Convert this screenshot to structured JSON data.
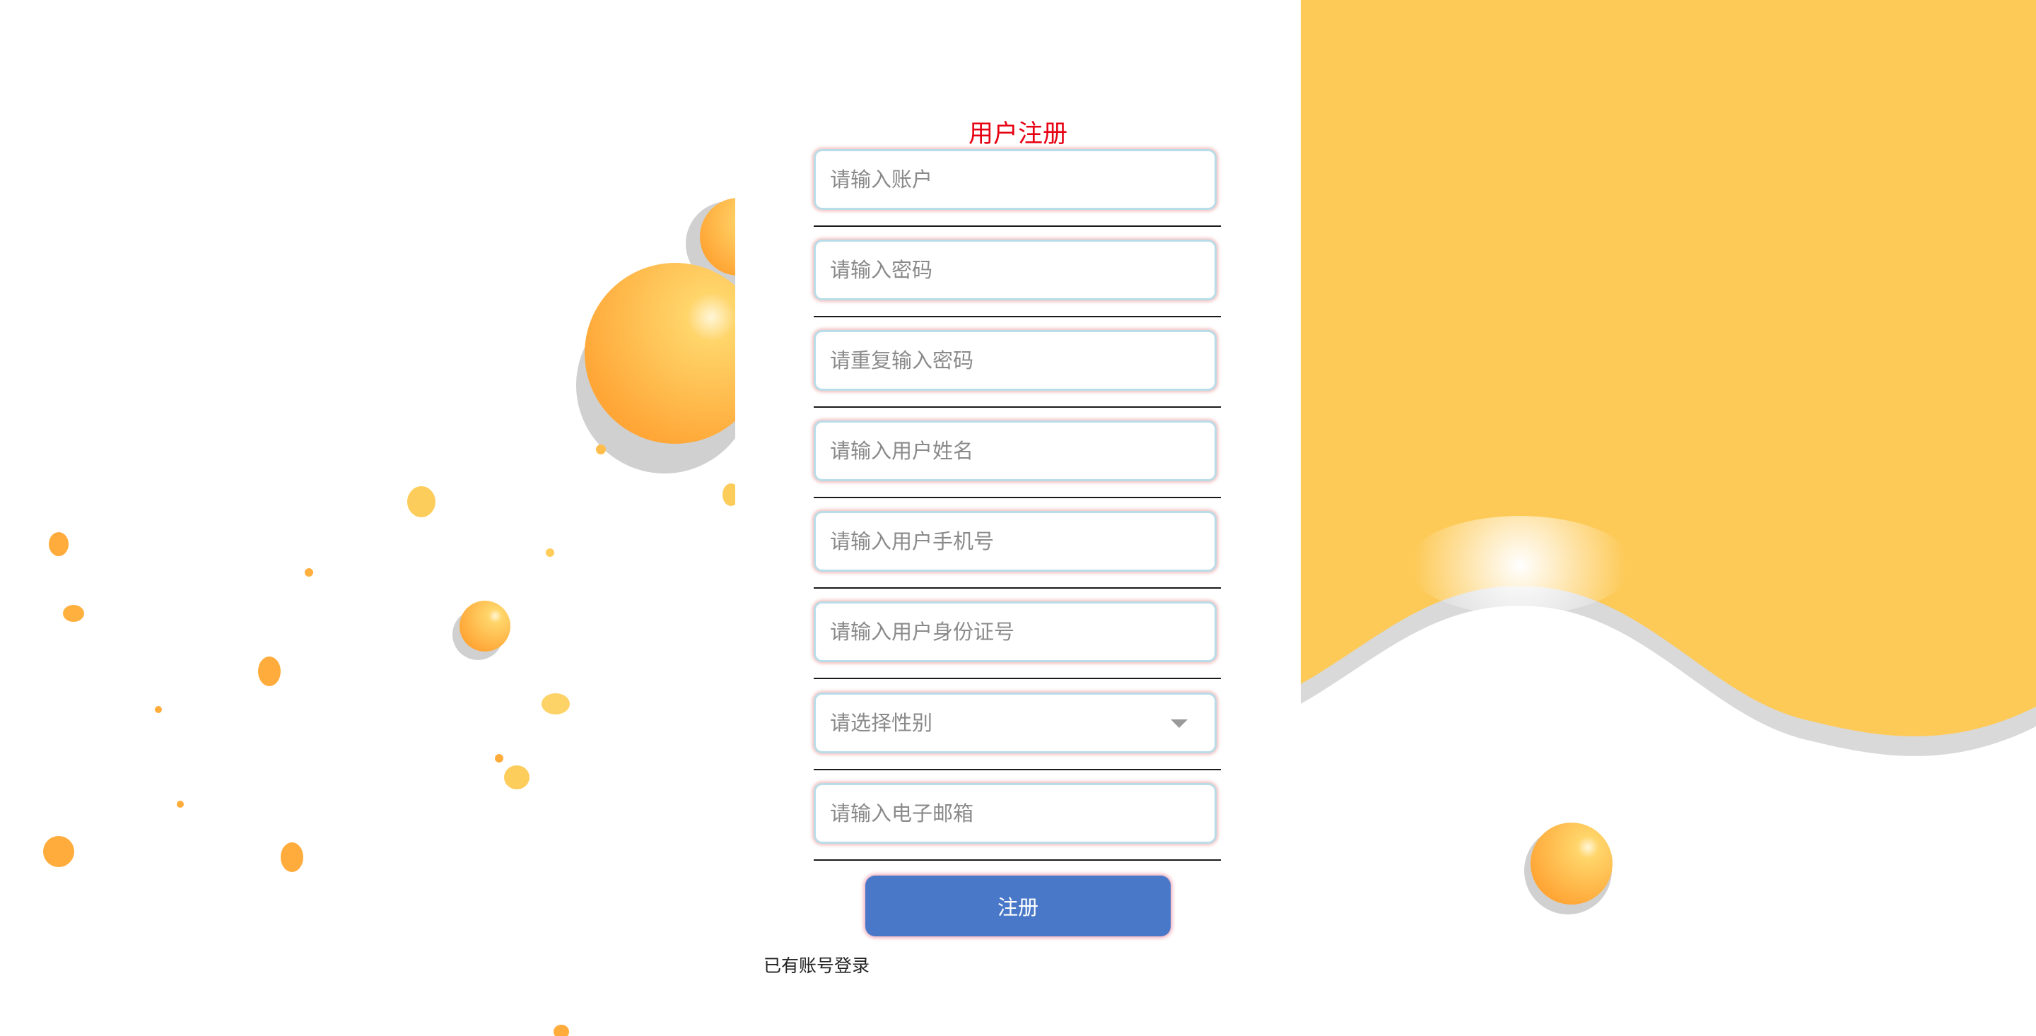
{
  "form": {
    "title": "用户注册",
    "account_placeholder": "请输入账户",
    "password_placeholder": "请输入密码",
    "repeat_password_placeholder": "请重复输入密码",
    "name_placeholder": "请输入用户姓名",
    "phone_placeholder": "请输入用户手机号",
    "id_card_placeholder": "请输入用户身份证号",
    "gender_placeholder": "请选择性别",
    "email_placeholder": "请输入电子邮箱",
    "submit_label": "注册",
    "login_link": "已有账号登录"
  },
  "colors": {
    "title": "#e60012",
    "button": "#4a78c8",
    "background_blob": "#fdca58"
  }
}
